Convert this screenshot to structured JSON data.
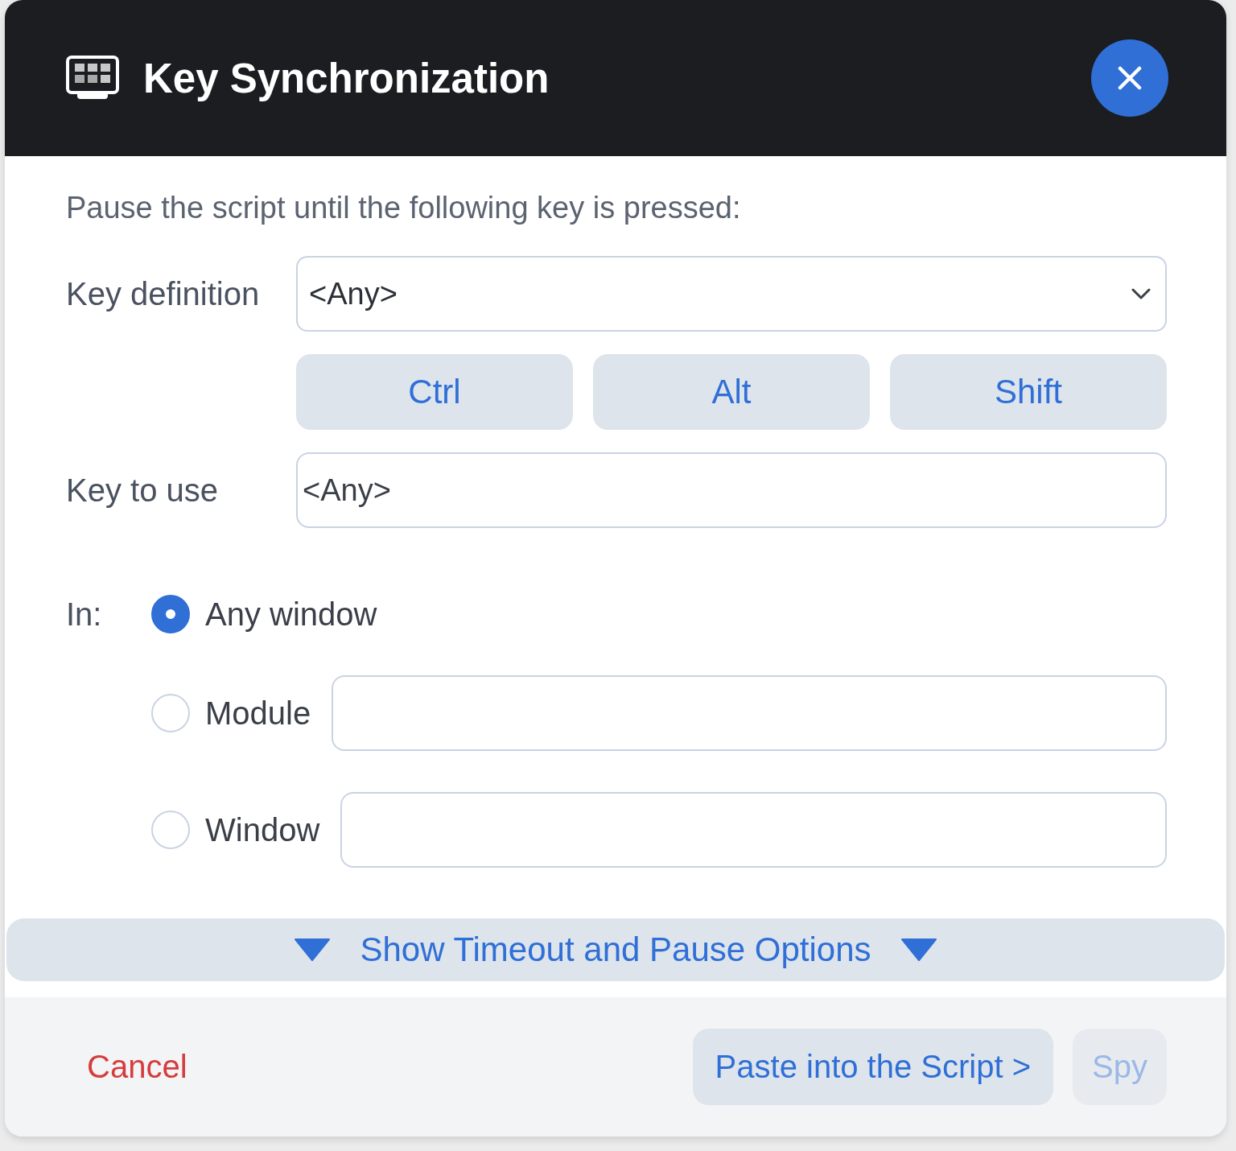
{
  "window": {
    "title": "Key Synchronization"
  },
  "instruction": "Pause the script until the following key is pressed:",
  "key_definition": {
    "label": "Key definition",
    "value": "<Any>"
  },
  "modifiers": [
    {
      "label": "Ctrl",
      "selected": false
    },
    {
      "label": "Alt",
      "selected": false
    },
    {
      "label": "Shift",
      "selected": false
    }
  ],
  "key_to_use": {
    "label": "Key to use",
    "value": "<Any>"
  },
  "scope": {
    "label": "In:",
    "options": [
      {
        "label": "Any window",
        "selected": true,
        "kind": "plain"
      },
      {
        "label": "Module",
        "selected": false,
        "kind": "field"
      },
      {
        "label": "Window",
        "selected": false,
        "kind": "field"
      }
    ]
  },
  "options_toggle": {
    "label": "Show Timeout and Pause Options",
    "expanded": false
  },
  "footer": {
    "cancel": "Cancel",
    "buttons": [
      {
        "label": "Paste into the Script >",
        "disabled": false
      },
      {
        "label": "Spy",
        "disabled": true
      }
    ]
  }
}
